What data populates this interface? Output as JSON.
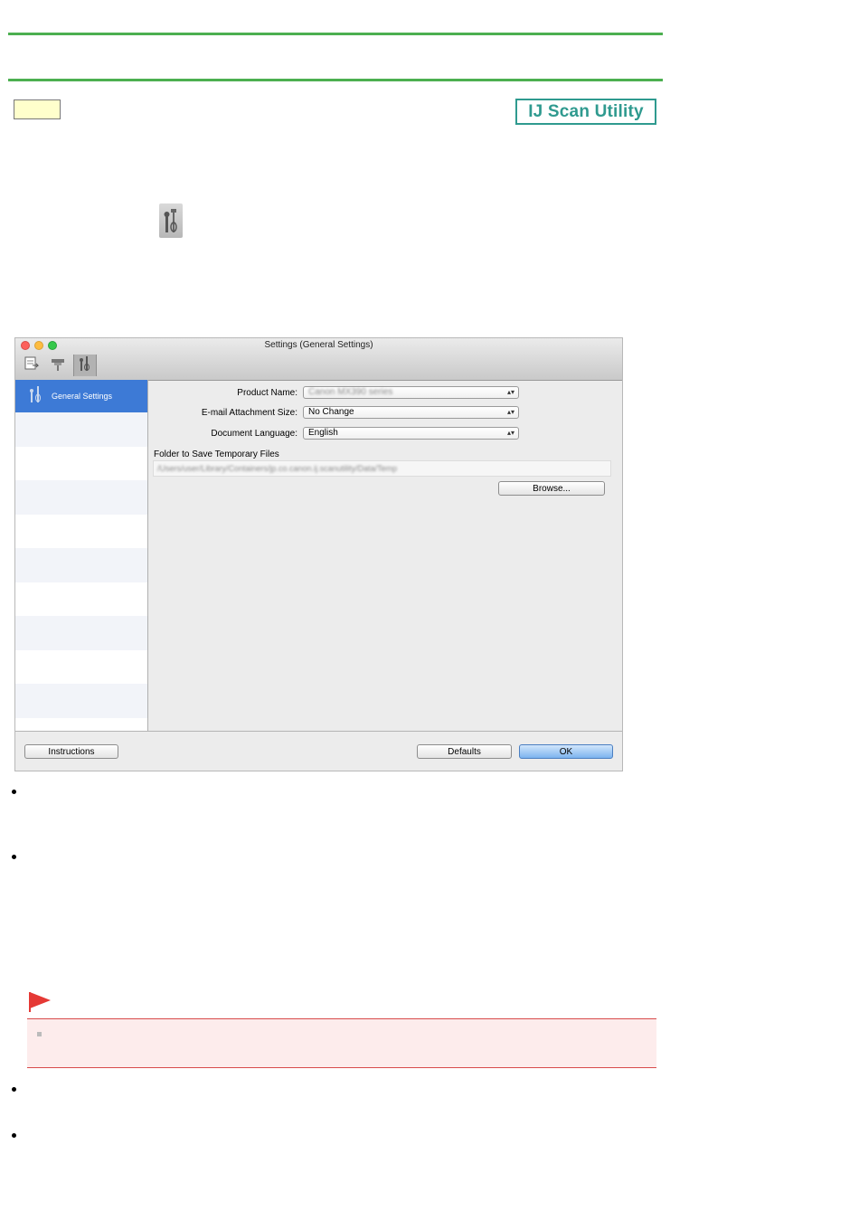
{
  "header": {
    "badge_text": "IJ Scan Utility"
  },
  "window": {
    "title": "Settings (General Settings)",
    "toolbar_icons": [
      "scan-to-computer-icon",
      "scanner-icon",
      "general-settings-icon"
    ],
    "sidebar": {
      "selected_label": "General Settings"
    },
    "form": {
      "product_name_label": "Product Name:",
      "product_name_value": "Canon MX390 series",
      "email_size_label": "E-mail Attachment Size:",
      "email_size_value": "No Change",
      "doc_lang_label": "Document Language:",
      "doc_lang_value": "English",
      "folder_label": "Folder to Save Temporary Files",
      "folder_path": "/Users/user/Library/Containers/jp.co.canon.ij.scanutility/Data/Temp",
      "browse_button": "Browse..."
    },
    "buttons": {
      "instructions": "Instructions",
      "defaults": "Defaults",
      "ok": "OK"
    }
  },
  "colors": {
    "rule": "#4caf50",
    "badge": "#2f9a8f",
    "selection": "#3d7ad6",
    "flag": "#e53935"
  }
}
